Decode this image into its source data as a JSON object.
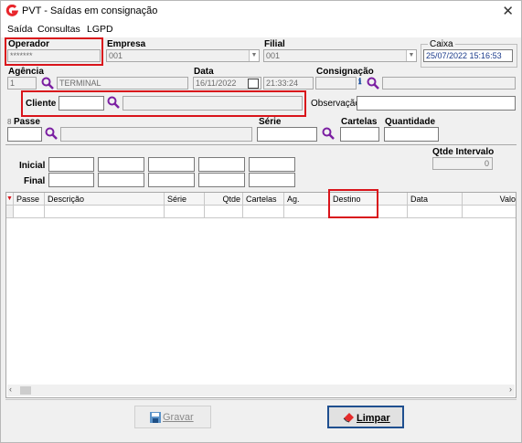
{
  "window": {
    "title": "PVT - Saídas em consignação",
    "close_glyph": "✕"
  },
  "menu": [
    "Saída",
    "Consultas",
    "LGPD"
  ],
  "operador": {
    "label": "Operador",
    "value": "*******"
  },
  "empresa": {
    "label": "Empresa",
    "value": "001"
  },
  "filial": {
    "label": "Filial",
    "value": "001"
  },
  "caixa": {
    "label": "Caixa",
    "value": "25/07/2022 15:16:53"
  },
  "agencia": {
    "label": "Agência",
    "code": "1",
    "name": "TERMINAL"
  },
  "data": {
    "label": "Data",
    "date": "16/11/2022",
    "time": "21:33:24"
  },
  "consignacao": {
    "label": "Consignação"
  },
  "cliente": {
    "label": "Cliente"
  },
  "observacao": {
    "label": "Observação"
  },
  "passe": {
    "label": "Passe"
  },
  "serie": {
    "label": "Série"
  },
  "cartelas": {
    "label": "Cartelas"
  },
  "quantidade": {
    "label": "Quantidade"
  },
  "intervalo": {
    "inicial_label": "Inicial",
    "final_label": "Final",
    "qtde_label": "Qtde Intervalo",
    "qtde_value": "0"
  },
  "table": {
    "columns": [
      "Passe",
      "Descrição",
      "Série",
      "Qtde",
      "Cartelas",
      "Ag.",
      "Destino",
      "Data",
      "Valo"
    ]
  },
  "buttons": {
    "gravar": "Gravar",
    "limpar": "Limpar"
  },
  "colors": {
    "highlight": "#d9141b",
    "search_icon": "#7b1fa2",
    "app_icon": "#e8262c"
  }
}
